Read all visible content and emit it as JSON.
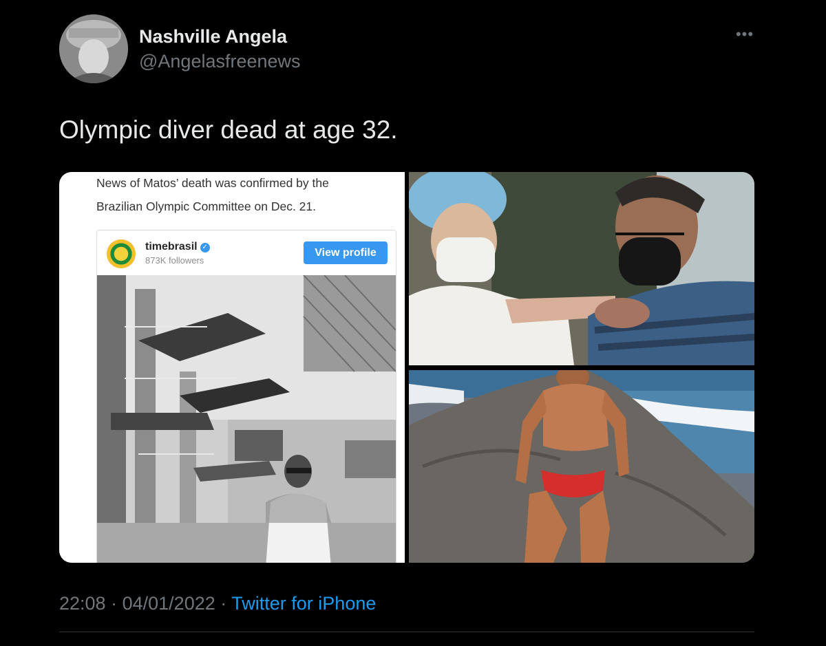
{
  "author": {
    "display_name": "Nashville Angela",
    "handle": "@Angelasfreenews"
  },
  "menu_icon": "more-horizontal-icon",
  "tweet": {
    "text": "Olympic diver dead at age 32."
  },
  "media": {
    "article": {
      "line1": "News of Matos’ death was confirmed by the",
      "line2": "Brazilian Olympic Committee on Dec. 21.",
      "instagram_card": {
        "account_name": "timebrasil",
        "followers": "873K followers",
        "button_label": "View profile"
      }
    },
    "photos": [
      "vaccination",
      "beach"
    ]
  },
  "meta": {
    "time": "22:08",
    "separator": "·",
    "date": "04/01/2022",
    "source": "Twitter for iPhone"
  },
  "colors": {
    "background": "#000000",
    "primary_text": "#e7e9ea",
    "secondary_text": "#71767b",
    "link": "#1d9bf0",
    "ig_button": "#3897f0"
  }
}
